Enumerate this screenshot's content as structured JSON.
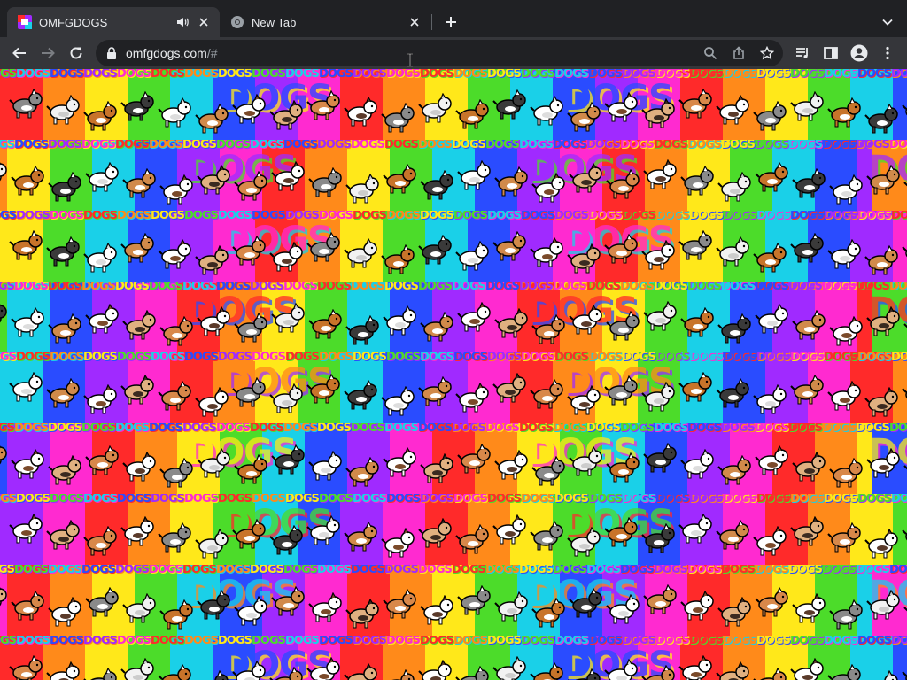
{
  "tabs": [
    {
      "title": "OMFGDOGS",
      "active": true,
      "audio": true
    },
    {
      "title": "New Tab",
      "active": false
    }
  ],
  "toolbar": {
    "url_host": "omfgdogs.com",
    "url_path": "/#"
  },
  "page": {
    "tile_text": "DOGS",
    "rainbow": [
      "#ff2a2a",
      "#ff8a1a",
      "#ffe81a",
      "#4cdc2a",
      "#1ad0e8",
      "#2a4cff",
      "#a02aff",
      "#ff2ad0"
    ]
  },
  "colors": {
    "tabstrip_bg": "#202124",
    "toolbar_bg": "#35363a",
    "omnibox_bg": "#202124",
    "text": "#e8eaed"
  }
}
